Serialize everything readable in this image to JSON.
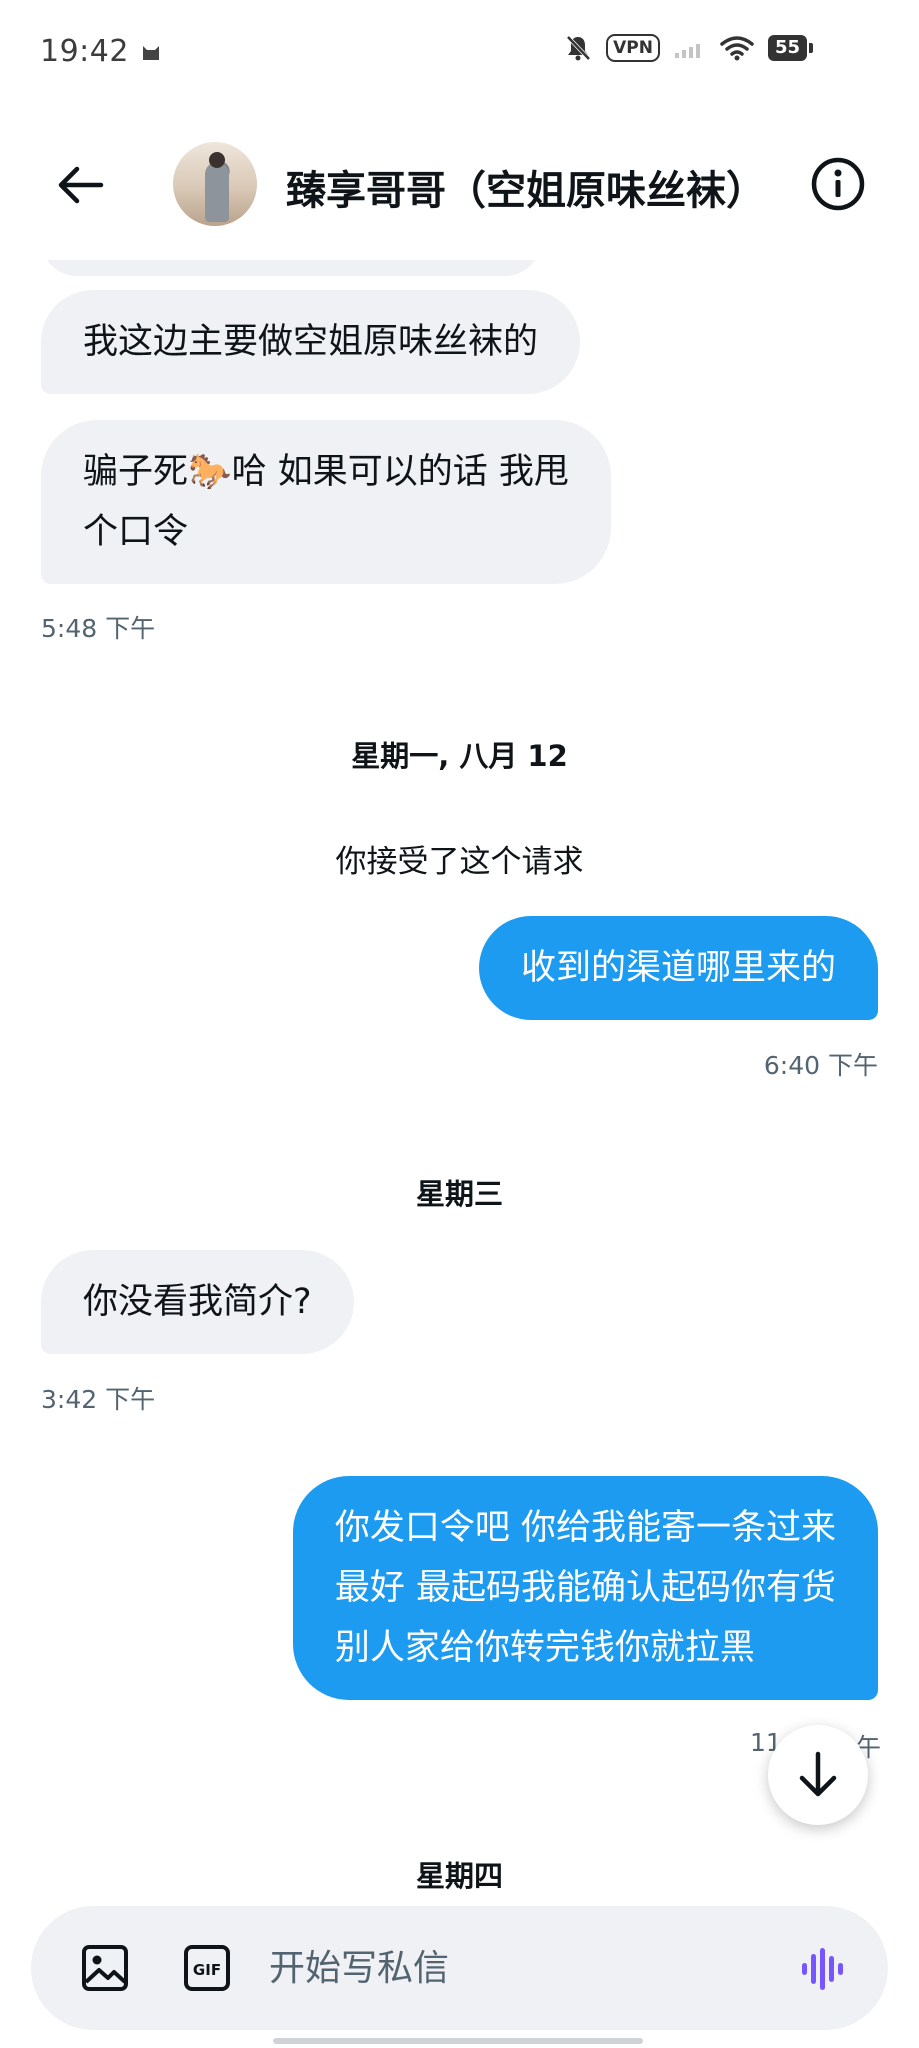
{
  "status_bar": {
    "time": "19:42",
    "vpn": "VPN",
    "battery": "55"
  },
  "header": {
    "contact_name": "臻享哥哥（空姐原味丝袜）"
  },
  "messages": {
    "m1": {
      "line1": "我这边主要做空姐原味丝袜的"
    },
    "m2": {
      "line1a": "骗子死",
      "emoji": "🐎",
      "line1b": "哈 如果可以的话 我甩",
      "line2": "个口令"
    },
    "ts1": "5:48 下午",
    "date1": "星期一, 八月 12",
    "system_note": "你接受了这个请求",
    "m3": {
      "line1": "收到的渠道哪里来的"
    },
    "ts2": "6:40 下午",
    "date2": "星期三",
    "m4": {
      "line1": "你没看我简介?"
    },
    "ts3": "3:42 下午",
    "m5": {
      "line1": "你发口令吧  你给我能寄一条过来",
      "line2": "最好  最起码我能确认起码你有货",
      "line3": "别人家给你转完钱你就拉黑"
    },
    "ts4": "11:",
    "ts4_tail": "午",
    "date3": "星期四"
  },
  "composer": {
    "placeholder": "开始写私信",
    "gif_label": "GIF"
  },
  "colors": {
    "outgoing_bubble": "#1d9bf0",
    "incoming_bubble": "#eff1f4",
    "voice_accent": "#7856ff"
  },
  "icons": [
    "back-arrow-icon",
    "info-icon",
    "scroll-down-arrow-icon",
    "image-icon",
    "gif-icon",
    "voice-wave-icon",
    "mute-bell-icon",
    "wifi-icon",
    "signal-icon",
    "cat-icon"
  ]
}
